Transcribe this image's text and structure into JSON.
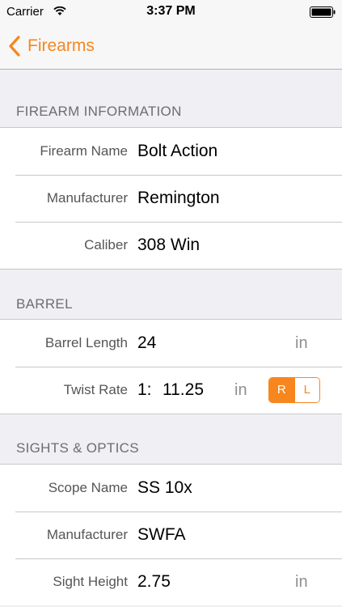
{
  "status": {
    "carrier": "Carrier",
    "time": "3:37 PM"
  },
  "nav": {
    "back_label": "Firearms"
  },
  "colors": {
    "accent": "#f7861e"
  },
  "firearm_info": {
    "header": "FIREARM INFORMATION",
    "rows": [
      {
        "label": "Firearm Name",
        "value": "Bolt Action"
      },
      {
        "label": "Manufacturer",
        "value": "Remington"
      },
      {
        "label": "Caliber",
        "value": "308 Win"
      }
    ]
  },
  "barrel": {
    "header": "BARREL",
    "barrel_length": {
      "label": "Barrel Length",
      "value": "24",
      "unit": "in"
    },
    "twist_rate": {
      "label": "Twist Rate",
      "prefix": "1:",
      "value": "11.25",
      "unit": "in",
      "direction_options": [
        "R",
        "L"
      ],
      "selected": "R"
    }
  },
  "sights": {
    "header": "SIGHTS & OPTICS",
    "rows": [
      {
        "label": "Scope Name",
        "value": "SS 10x"
      },
      {
        "label": "Manufacturer",
        "value": "SWFA"
      }
    ],
    "sight_height": {
      "label": "Sight Height",
      "value": "2.75",
      "unit": "in"
    }
  }
}
